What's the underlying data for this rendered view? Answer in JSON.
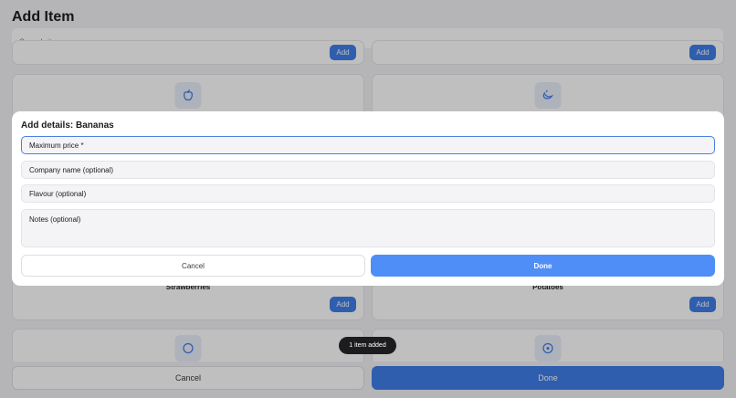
{
  "page": {
    "title": "Add Item",
    "search_placeholder": "Search items...",
    "add_label": "Add",
    "cards": [
      {
        "label": "Strawberries",
        "icon": "apple-icon"
      },
      {
        "label": "Potatoes",
        "icon": "banana-icon"
      }
    ],
    "cancel_label": "Cancel",
    "done_label": "Done"
  },
  "toast": {
    "text": "1 item added"
  },
  "modal": {
    "title": "Add details: Bananas",
    "fields": {
      "max_price": "Maximum price *",
      "company": "Company name (optional)",
      "flavour": "Flavour (optional)",
      "notes": "Notes (optional)"
    },
    "cancel_label": "Cancel",
    "done_label": "Done"
  },
  "colors": {
    "accent": "#4f8ef7",
    "accent_dark": "#3f7ee8"
  }
}
